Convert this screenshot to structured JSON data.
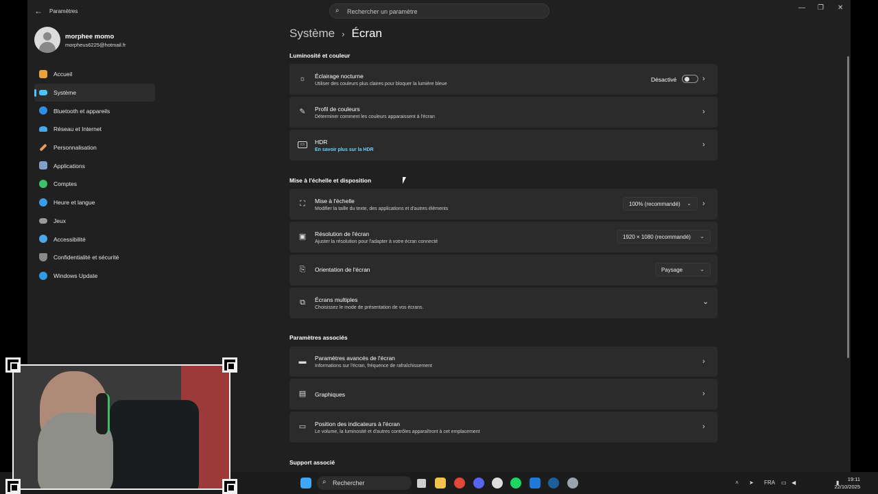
{
  "window": {
    "title": "Paramètres",
    "search_placeholder": "Rechercher un paramètre",
    "controls": {
      "minimize": "—",
      "maximize": "❐",
      "close": "✕"
    }
  },
  "user": {
    "name": "morphee momo",
    "email": "morpheus6225@hotmail.fr"
  },
  "sidebar": {
    "items": [
      {
        "label": "Accueil",
        "icon": "home-icon",
        "color": "#e8a33a"
      },
      {
        "label": "Système",
        "icon": "monitor-icon",
        "color": "#4cc2ff"
      },
      {
        "label": "Bluetooth et appareils",
        "icon": "bluetooth-icon",
        "color": "#2f8ee8"
      },
      {
        "label": "Réseau et Internet",
        "icon": "wifi-icon",
        "color": "#4aa8e8"
      },
      {
        "label": "Personnalisation",
        "icon": "brush-icon",
        "color": "#e89a5c"
      },
      {
        "label": "Applications",
        "icon": "apps-icon",
        "color": "#7fa0c8"
      },
      {
        "label": "Comptes",
        "icon": "person-icon",
        "color": "#3ec26a"
      },
      {
        "label": "Heure et langue",
        "icon": "globe-icon",
        "color": "#3b9be8"
      },
      {
        "label": "Jeux",
        "icon": "gamepad-icon",
        "color": "#9a9a9a"
      },
      {
        "label": "Accessibilité",
        "icon": "accessibility-icon",
        "color": "#4aa8e8"
      },
      {
        "label": "Confidentialité et sécurité",
        "icon": "shield-icon",
        "color": "#8a8a8a"
      },
      {
        "label": "Windows Update",
        "icon": "update-icon",
        "color": "#2f9be8"
      }
    ]
  },
  "breadcrumb": {
    "parent": "Système",
    "separator": "›",
    "current": "Écran"
  },
  "sections": {
    "brightness": "Luminosité et couleur",
    "scale": "Mise à l'échelle et disposition",
    "related": "Paramètres associés",
    "support": "Support associé"
  },
  "cards": {
    "night": {
      "title": "Éclairage nocturne",
      "desc": "Utiliser des couleurs plus claires pour bloquer la lumière bleue",
      "state": "Désactivé"
    },
    "profile": {
      "title": "Profil de couleurs",
      "desc": "Déterminer comment les couleurs apparaissent à l'écran"
    },
    "hdr": {
      "title": "HDR",
      "link": "En savoir plus sur la HDR"
    },
    "scaling": {
      "title": "Mise à l'échelle",
      "desc": "Modifier la taille du texte, des applications et d'autres éléments",
      "value": "100% (recommandé)"
    },
    "resolution": {
      "title": "Résolution de l'écran",
      "desc": "Ajuster la résolution pour l'adapter à  votre  écran connecté",
      "value": "1920 × 1080 (recommandé)"
    },
    "orientation": {
      "title": "Orientation de l'écran",
      "value": "Paysage"
    },
    "multi": {
      "title": "Écrans multiples",
      "desc": "Choisissez le mode de présentation de vos écrans."
    },
    "advanced": {
      "title": "Paramètres avancés de l'écran",
      "desc": "Informations sur l'écran, fréquence de rafraîchissement"
    },
    "graphics": {
      "title": "Graphiques"
    },
    "indicators": {
      "title": "Position des indicateurs à l'écran",
      "desc": "Le volume, la luminosité et d'autres contrôles apparaîtront à cet emplacement"
    }
  },
  "taskbar": {
    "search_label": "Rechercher",
    "lang": "FRA",
    "time": "19:11",
    "date": "22/10/2025",
    "apps": [
      {
        "icon": "windows-start-icon",
        "color": "#3fa7f5"
      },
      {
        "icon": "task-view-icon",
        "color": "#cfcfcf"
      },
      {
        "icon": "file-explorer-icon",
        "color": "#f2c34a"
      },
      {
        "icon": "chrome-icon",
        "color": "#e0483a"
      },
      {
        "icon": "discord-icon",
        "color": "#5865f2"
      },
      {
        "icon": "openai-icon",
        "color": "#dddddd"
      },
      {
        "icon": "spotify-icon",
        "color": "#1ed760"
      },
      {
        "icon": "outlook-icon",
        "color": "#1f7ad8"
      },
      {
        "icon": "steam-icon",
        "color": "#1b5e9a"
      },
      {
        "icon": "settings-icon",
        "color": "#9aa4ae"
      }
    ]
  }
}
